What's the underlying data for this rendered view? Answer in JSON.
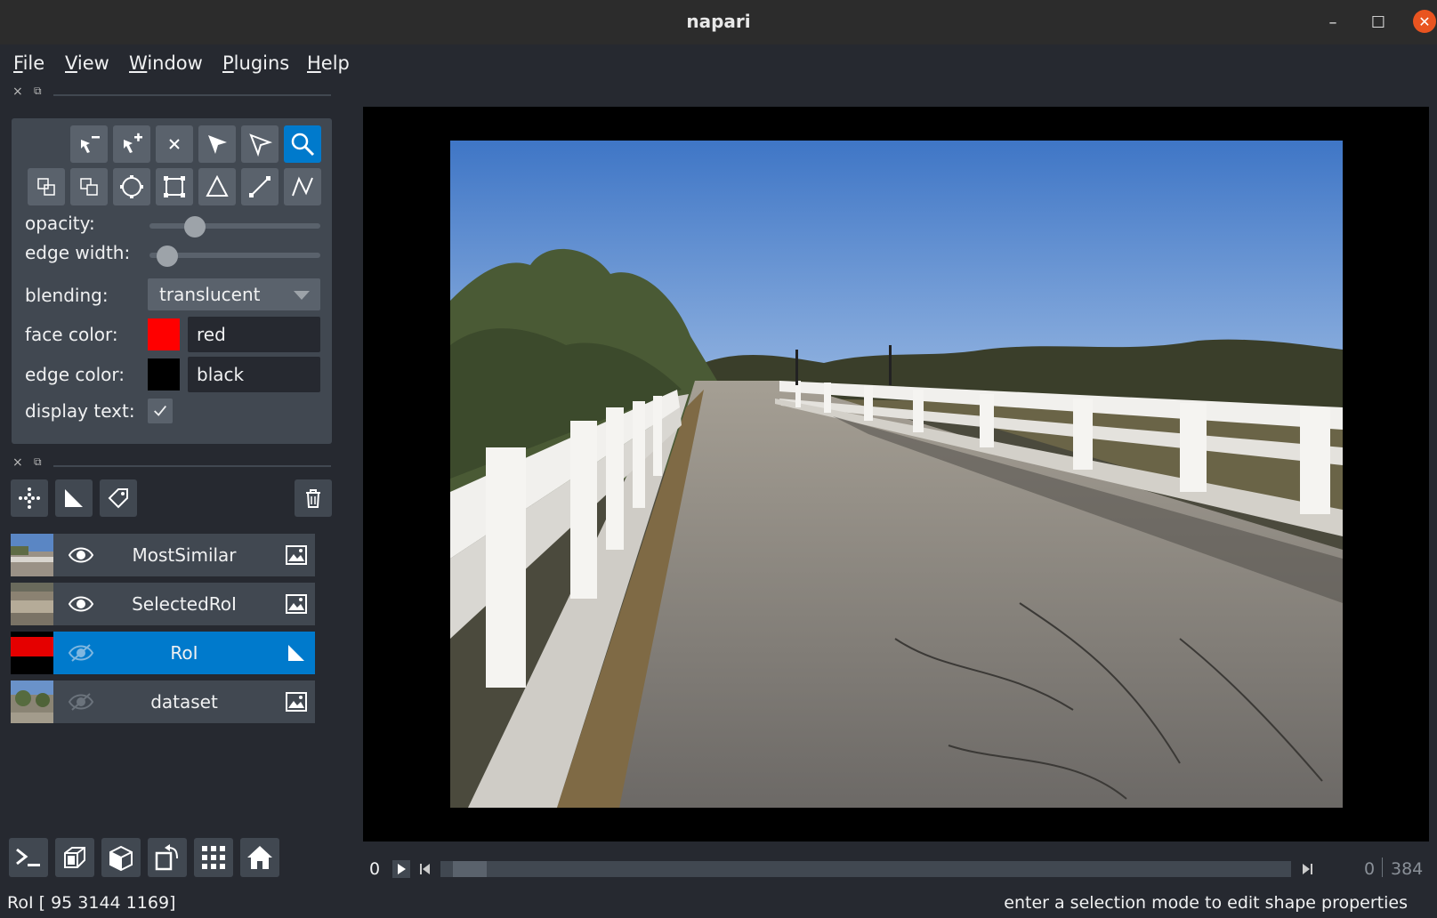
{
  "window": {
    "title": "napari"
  },
  "menu": [
    {
      "label": "File",
      "mnemonic": "F",
      "rest": "ile"
    },
    {
      "label": "View",
      "mnemonic": "V",
      "rest": "iew"
    },
    {
      "label": "Window",
      "mnemonic": "W",
      "rest": "indow"
    },
    {
      "label": "Plugins",
      "mnemonic": "P",
      "rest": "lugins"
    },
    {
      "label": "Help",
      "mnemonic": "H",
      "rest": "elp"
    }
  ],
  "controls": {
    "opacity_label": "opacity:",
    "opacity_value": 0.23,
    "edge_width_label": "edge width:",
    "edge_width_value": 0.05,
    "blending_label": "blending:",
    "blending_value": "translucent",
    "face_color_label": "face color:",
    "face_color_name": "red",
    "face_color_hex": "#ff0000",
    "edge_color_label": "edge color:",
    "edge_color_name": "black",
    "edge_color_hex": "#000000",
    "display_text_label": "display text:",
    "display_text_checked": true
  },
  "layers": [
    {
      "name": "MostSimilar",
      "visible": true,
      "type_icon": "image-icon",
      "selected": false
    },
    {
      "name": "SelectedRoI",
      "visible": true,
      "type_icon": "image-icon",
      "selected": false
    },
    {
      "name": "RoI",
      "visible": false,
      "type_icon": "shapes-icon",
      "selected": true
    },
    {
      "name": "dataset",
      "visible": false,
      "type_icon": "image-icon",
      "selected": false
    }
  ],
  "dims": {
    "current_left": "0",
    "current_right": "0",
    "max": "384",
    "position": 0.015
  },
  "status": {
    "left": "RoI [ 95 3144 1169]",
    "right": "enter a selection mode to edit shape properties"
  },
  "colors": {
    "accent": "#007acc",
    "panel": "#414851",
    "background": "#262930",
    "button": "#5a626c"
  }
}
